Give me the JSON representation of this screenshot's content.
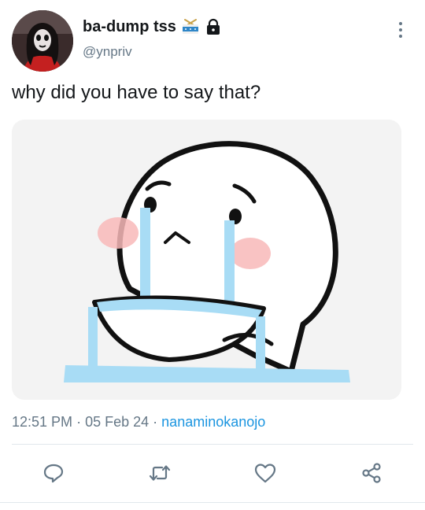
{
  "author": {
    "display_name": "ba-dump tss",
    "handle": "@ynpriv",
    "badges": [
      "drum-icon",
      "lock-icon"
    ]
  },
  "tweet": {
    "text": "why did you have to say that?",
    "time": "12:51 PM",
    "date": "05 Feb 24",
    "separator": "·",
    "source": "nanaminokanojo"
  },
  "actions": [
    "reply-icon",
    "retweet-icon",
    "like-icon",
    "share-icon"
  ],
  "colors": {
    "text": "#14171a",
    "secondary": "#657786",
    "link": "#1b95e0",
    "tears": "#a8dcf5",
    "blush": "#f8b9b9"
  }
}
